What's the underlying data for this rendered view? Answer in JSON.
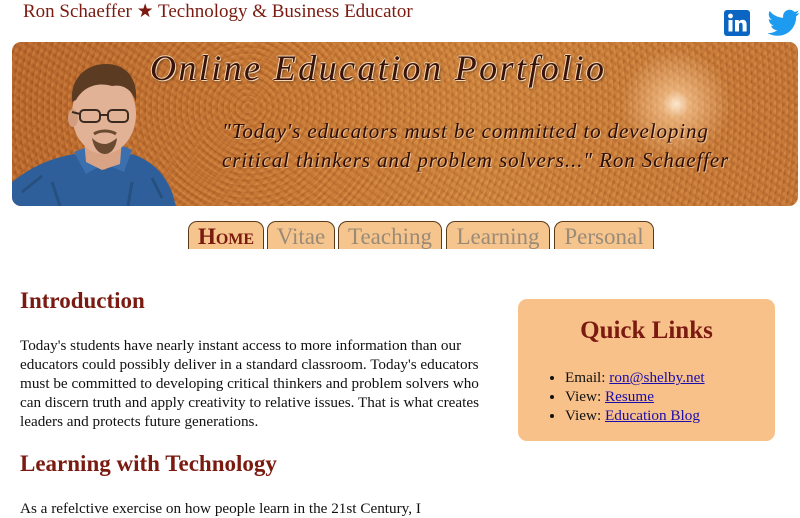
{
  "header": {
    "site_title": "Ron Schaeffer ★ Technology & Business Educator",
    "linkedin_icon": "linkedin-icon",
    "twitter_icon": "twitter-icon",
    "colors": {
      "title": "#7a1a10",
      "linkedin": "#0a66c2",
      "twitter": "#1d9bf0"
    }
  },
  "banner": {
    "title": "Online Education Portfolio",
    "quote": "\"Today's educators must be committed to developing critical thinkers and problem solvers...\" Ron Schaeffer",
    "portrait": "portrait-photo"
  },
  "nav": {
    "tabs": [
      {
        "label": "Home",
        "active": true
      },
      {
        "label": "Vitae",
        "active": false
      },
      {
        "label": "Teaching",
        "active": false
      },
      {
        "label": "Learning",
        "active": false
      },
      {
        "label": "Personal",
        "active": false
      }
    ]
  },
  "main": {
    "intro_heading": "Introduction",
    "intro_text": "Today's students have nearly instant access to more information than our educators could possibly deliver in a standard classroom. Today's educators must be committed to developing critical thinkers and problem solvers who can discern truth and apply creativity to relative issues. That is what creates leaders and protects future generations.",
    "tech_heading": "Learning with Technology",
    "tech_text": "As a refelctive exercise on how people learn in the 21st Century, I"
  },
  "quick_links": {
    "title": "Quick Links",
    "items": [
      {
        "prefix": "Email: ",
        "link": "ron@shelby.net"
      },
      {
        "prefix": "View: ",
        "link": "Resume"
      },
      {
        "prefix": "View: ",
        "link": "Education Blog"
      }
    ],
    "background": "#f8c18a"
  }
}
